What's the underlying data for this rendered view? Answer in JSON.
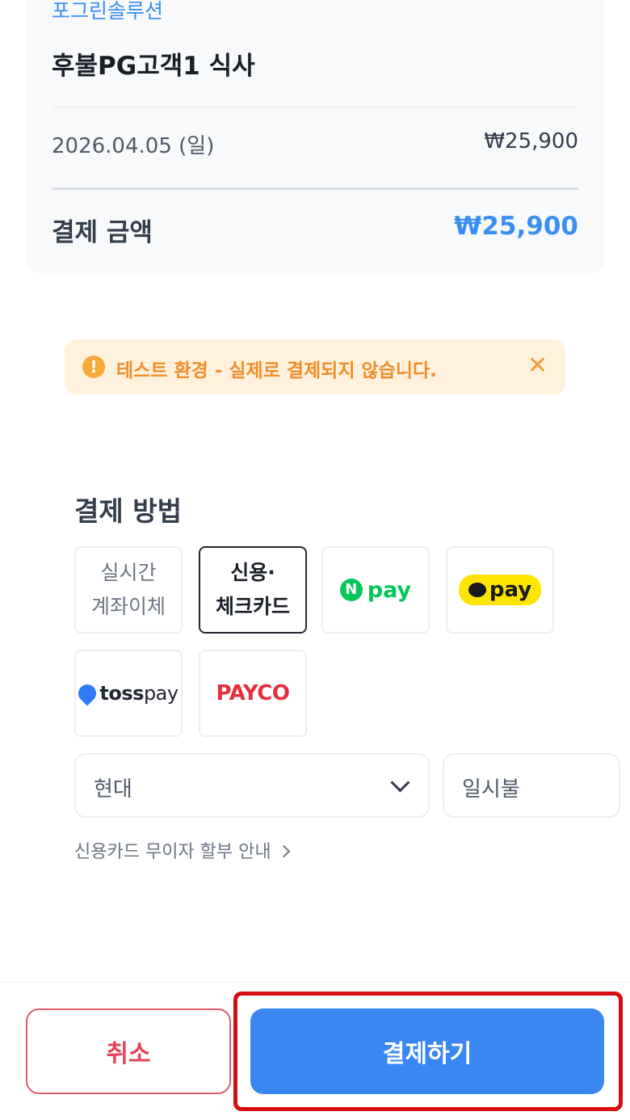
{
  "summary": {
    "merchant": "포그린솔루션",
    "product": "후불PG고객1 식사",
    "date": "2026.04.05 (일)",
    "item_amount": "₩25,900",
    "total_label": "결제 금액",
    "total_amount": "₩25,900"
  },
  "notice": {
    "icon_glyph": "!",
    "text": "테스트 환경 - 실제로 결제되지 않습니다.",
    "close_glyph": "✕"
  },
  "payment": {
    "title": "결제 방법",
    "methods": [
      {
        "label": "실시간\n계좌이체",
        "selected": false
      },
      {
        "label": "신용·\n체크카드",
        "selected": true
      },
      {
        "label_icon": "N",
        "label": "pay"
      },
      {
        "label": "pay"
      },
      {
        "label_bold": "toss",
        "label_light": "pay"
      },
      {
        "label": "PAYCO"
      }
    ],
    "card_company": "현대",
    "installment": "일시불",
    "installment_info": "신용카드 무이자 할부 안내"
  },
  "actions": {
    "cancel_label": "취소",
    "pay_label": "결제하기"
  },
  "colors": {
    "accent": "#3a87f1",
    "cancel": "#e2435a",
    "highlight": "#d50d10"
  }
}
